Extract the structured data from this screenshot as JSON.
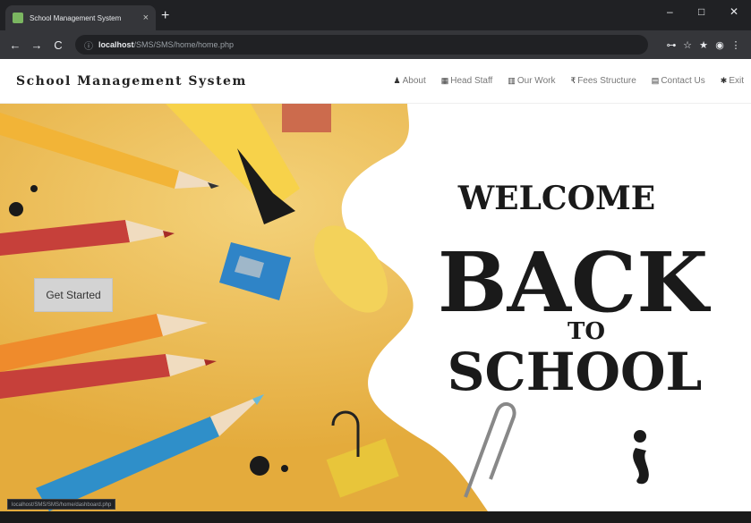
{
  "browser": {
    "tab_title": "School Management System",
    "tab_close": "×",
    "new_tab": "+",
    "url_host": "localhost",
    "url_path": "/SMS/SMS/home/home.php",
    "nav": {
      "back": "←",
      "forward": "→",
      "reload": "C",
      "info": "ⓘ"
    },
    "toolbar_icons": [
      "⊶",
      "☆",
      "★",
      "◉",
      "⋮"
    ],
    "window_controls": {
      "minimize": "–",
      "restore": "□",
      "close": "✕"
    }
  },
  "navbar": {
    "brand": "School Management System",
    "links": [
      {
        "icon": "♟",
        "label": "About",
        "icon_name": "user-icon"
      },
      {
        "icon": "▦",
        "label": "Head Staff",
        "icon_name": "staff-icon"
      },
      {
        "icon": "▥",
        "label": "Our Work",
        "icon_name": "work-icon"
      },
      {
        "icon": "₹",
        "label": "Fees Structure",
        "icon_name": "rupee-icon"
      },
      {
        "icon": "▤",
        "label": "Contact Us",
        "icon_name": "contact-icon"
      },
      {
        "icon": "✱",
        "label": "Exit",
        "icon_name": "exit-icon"
      }
    ]
  },
  "hero": {
    "line1": "WELCOME",
    "line2": "BACK",
    "line3": "TO",
    "line4": "SCHOOL",
    "cta": "Get Started"
  },
  "status_bar": {
    "url": "localhost/SMS/SMS/home/dashboard.php"
  }
}
